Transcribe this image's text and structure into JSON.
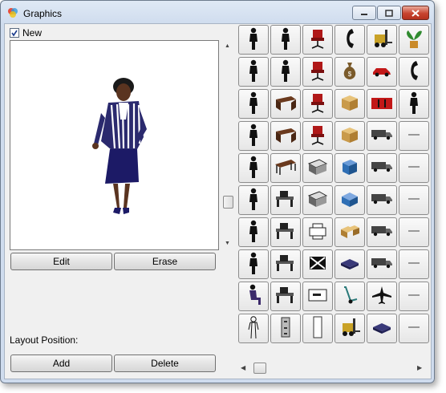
{
  "window": {
    "title": "Graphics",
    "accent": "#c7432f"
  },
  "options": {
    "new_label": "New",
    "new_checked": true
  },
  "buttons": {
    "edit": "Edit",
    "erase": "Erase",
    "add": "Add",
    "delete": "Delete"
  },
  "layout": {
    "position_label": "Layout Position:"
  },
  "gallery": {
    "columns": 6,
    "cells": [
      {
        "icon": "person-standing-icon"
      },
      {
        "icon": "person-standing-icon"
      },
      {
        "icon": "chair-icon"
      },
      {
        "icon": "telephone-icon"
      },
      {
        "icon": "forklift-icon"
      },
      {
        "icon": "plant-icon"
      },
      {
        "icon": "person-standing-icon"
      },
      {
        "icon": "person-standing-icon"
      },
      {
        "icon": "chair-icon"
      },
      {
        "icon": "money-bag-icon"
      },
      {
        "icon": "car-icon"
      },
      {
        "icon": "telephone-icon"
      },
      {
        "icon": "person-standing-icon"
      },
      {
        "icon": "desk-icon"
      },
      {
        "icon": "chair-icon"
      },
      {
        "icon": "box-icon"
      },
      {
        "icon": "cabinet-icon"
      },
      {
        "icon": "person-standing-icon"
      },
      {
        "icon": "person-standing-icon"
      },
      {
        "icon": "desk-icon"
      },
      {
        "icon": "chair-icon"
      },
      {
        "icon": "box-icon"
      },
      {
        "icon": "truck-icon"
      },
      {
        "icon": "small-label-icon"
      },
      {
        "icon": "person-standing-icon"
      },
      {
        "icon": "table-icon"
      },
      {
        "icon": "copier-icon"
      },
      {
        "icon": "server-icon"
      },
      {
        "icon": "truck-icon"
      },
      {
        "icon": "small-label-icon"
      },
      {
        "icon": "person-standing-icon"
      },
      {
        "icon": "workstation-icon"
      },
      {
        "icon": "copier-icon"
      },
      {
        "icon": "machine-icon"
      },
      {
        "icon": "truck-icon"
      },
      {
        "icon": "small-label-icon"
      },
      {
        "icon": "person-standing-icon"
      },
      {
        "icon": "workstation-icon"
      },
      {
        "icon": "printer-icon"
      },
      {
        "icon": "boxes-icon"
      },
      {
        "icon": "truck-icon"
      },
      {
        "icon": "small-label-icon"
      },
      {
        "icon": "person-standing-icon"
      },
      {
        "icon": "workstation-icon"
      },
      {
        "icon": "envelope-icon"
      },
      {
        "icon": "pallet-icon"
      },
      {
        "icon": "truck-icon"
      },
      {
        "icon": "small-label-icon"
      },
      {
        "icon": "person-sitting-icon"
      },
      {
        "icon": "workstation-icon"
      },
      {
        "icon": "sign-icon"
      },
      {
        "icon": "hand-truck-icon"
      },
      {
        "icon": "airplane-icon"
      },
      {
        "icon": "small-label-icon"
      },
      {
        "icon": "person-outline-icon"
      },
      {
        "icon": "filing-cabinet-icon"
      },
      {
        "icon": "door-icon"
      },
      {
        "icon": "forklift-icon"
      },
      {
        "icon": "pallet-icon"
      },
      {
        "icon": "small-label-icon"
      }
    ]
  }
}
